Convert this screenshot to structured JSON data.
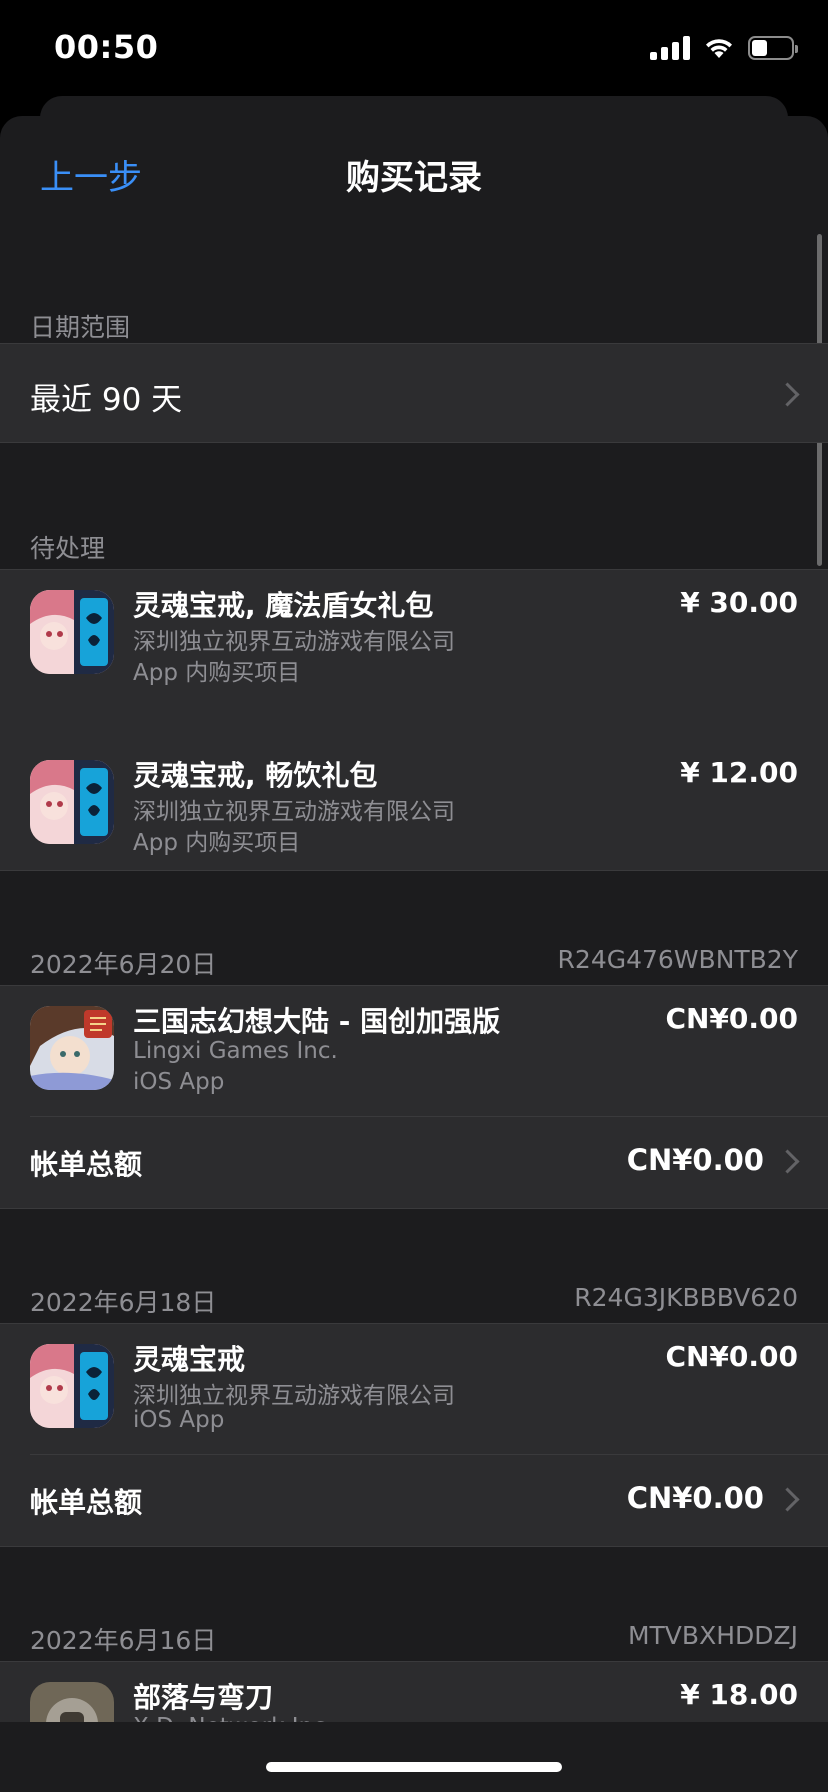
{
  "status": {
    "time": "00:50",
    "battery_percent": 40
  },
  "nav": {
    "back_label": "上一步",
    "title": "购买记录"
  },
  "date_range": {
    "header": "日期范围",
    "value": "最近 90 天"
  },
  "pending": {
    "header": "待处理",
    "items": [
      {
        "title": "灵魂宝戒, 魔法盾女礼包",
        "developer": "深圳独立视界互动游戏有限公司",
        "type": "App 内购买项目",
        "price": "¥ 30.00",
        "icon": "soul-ring-app-icon"
      },
      {
        "title": "灵魂宝戒, 畅饮礼包",
        "developer": "深圳独立视界互动游戏有限公司",
        "type": "App 内购买项目",
        "price": "¥ 12.00",
        "icon": "soul-ring-app-icon"
      }
    ]
  },
  "orders": [
    {
      "date": "2022年6月20日",
      "order_id": "R24G476WBNTB2Y",
      "item": {
        "title": "三国志幻想大陆 - 国创加强版",
        "developer": "Lingxi Games Inc.",
        "type": "iOS App",
        "price": "CN¥0.00",
        "icon": "three-kingdoms-app-icon"
      },
      "total_label": "帐单总额",
      "total_value": "CN¥0.00"
    },
    {
      "date": "2022年6月18日",
      "order_id": "R24G3JKBBBV620",
      "item": {
        "title": "灵魂宝戒",
        "developer": "深圳独立视界互动游戏有限公司",
        "type": "iOS App",
        "price": "CN¥0.00",
        "icon": "soul-ring-app-icon"
      },
      "total_label": "帐单总额",
      "total_value": "CN¥0.00"
    },
    {
      "date": "2022年6月16日",
      "order_id": "MTVBXHDDZJ",
      "item": {
        "title": "部落与弯刀",
        "developer": "X.D. Network Inc.",
        "price": "¥ 18.00",
        "icon": "tribe-blade-app-icon"
      }
    }
  ],
  "colors": {
    "accent": "#3a8ff7",
    "background": "#1c1c1e",
    "cell": "#2c2c2e",
    "secondary_text": "#8e8e93"
  }
}
